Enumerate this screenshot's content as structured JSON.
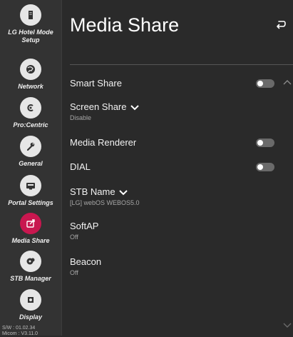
{
  "sidebar": {
    "items": [
      {
        "label": "LG Hotel Mode Setup",
        "icon": "hotel-icon"
      },
      {
        "label": "Network",
        "icon": "globe-icon"
      },
      {
        "label": "Pro:Centric",
        "icon": "procentric-icon"
      },
      {
        "label": "General",
        "icon": "wrench-icon"
      },
      {
        "label": "Portal Settings",
        "icon": "portal-icon"
      },
      {
        "label": "Media Share",
        "icon": "share-icon",
        "active": true
      },
      {
        "label": "STB Manager",
        "icon": "stb-icon"
      },
      {
        "label": "Display",
        "icon": "display-icon"
      }
    ],
    "sw_line1": "S/W : 01.02.34",
    "sw_line2": "Micom : V3.11.0"
  },
  "header": {
    "title": "Media Share"
  },
  "settings": {
    "smart_share": {
      "label": "Smart Share",
      "toggle": "off"
    },
    "screen_share": {
      "label": "Screen Share",
      "value": "Disable"
    },
    "media_renderer": {
      "label": "Media Renderer",
      "toggle": "off"
    },
    "dial": {
      "label": "DIAL",
      "toggle": "off"
    },
    "stb_name": {
      "label": "STB Name",
      "value": "[LG] webOS WEBOS5.0"
    },
    "softap": {
      "label": "SoftAP",
      "value": "Off"
    },
    "beacon": {
      "label": "Beacon",
      "value": "Off"
    }
  },
  "colors": {
    "accent": "#c8174f",
    "background": "#2a2a2a",
    "sidebar": "#333333"
  }
}
